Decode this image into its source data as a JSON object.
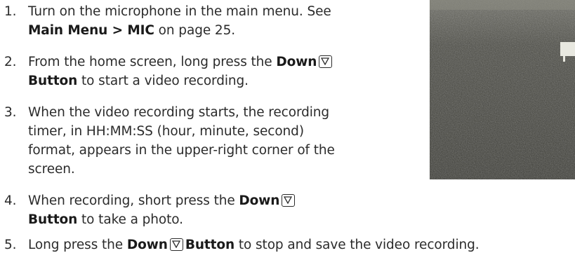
{
  "steps": [
    {
      "number": "1.",
      "lines": [
        {
          "parts": [
            {
              "text": "Turn on the microphone in the main menu. See"
            }
          ]
        },
        {
          "parts": [
            {
              "text": "Main Menu > MIC",
              "bold": true
            },
            {
              "text": " on page 25."
            }
          ]
        }
      ]
    },
    {
      "number": "2.",
      "lines": [
        {
          "parts": [
            {
              "text": "From the home screen, long press the "
            },
            {
              "text": "Down",
              "bold": true
            },
            {
              "icon": "down-button-icon"
            }
          ]
        },
        {
          "parts": [
            {
              "text": "Button",
              "bold": true
            },
            {
              "text": " to start a video recording."
            }
          ]
        }
      ]
    },
    {
      "number": "3.",
      "lines": [
        {
          "parts": [
            {
              "text": "When the video recording starts, the recording"
            }
          ]
        },
        {
          "parts": [
            {
              "text": "timer, in HH:MM:SS (hour, minute, second)"
            }
          ]
        },
        {
          "parts": [
            {
              "text": "format, appears in the upper-right corner of the"
            }
          ]
        },
        {
          "parts": [
            {
              "text": "screen."
            }
          ]
        }
      ]
    },
    {
      "number": "4.",
      "lines": [
        {
          "parts": [
            {
              "text": "When recording, short press the "
            },
            {
              "text": "Down",
              "bold": true
            },
            {
              "icon": "down-button-icon"
            }
          ]
        },
        {
          "parts": [
            {
              "text": "Button",
              "bold": true
            },
            {
              "text": " to take a photo."
            }
          ]
        }
      ]
    },
    {
      "number": "5.",
      "lines": [
        {
          "parts": [
            {
              "text": "Long press the "
            },
            {
              "text": "Down",
              "bold": true
            },
            {
              "icon": "down-button-icon"
            },
            {
              "text": "Button",
              "bold": true
            },
            {
              "text": " to stop and save the video recording."
            }
          ]
        }
      ]
    }
  ],
  "colors": {
    "text": "#2b2b2b",
    "photo_dark": "#3a3a34",
    "photo_light": "#8a8a80"
  }
}
